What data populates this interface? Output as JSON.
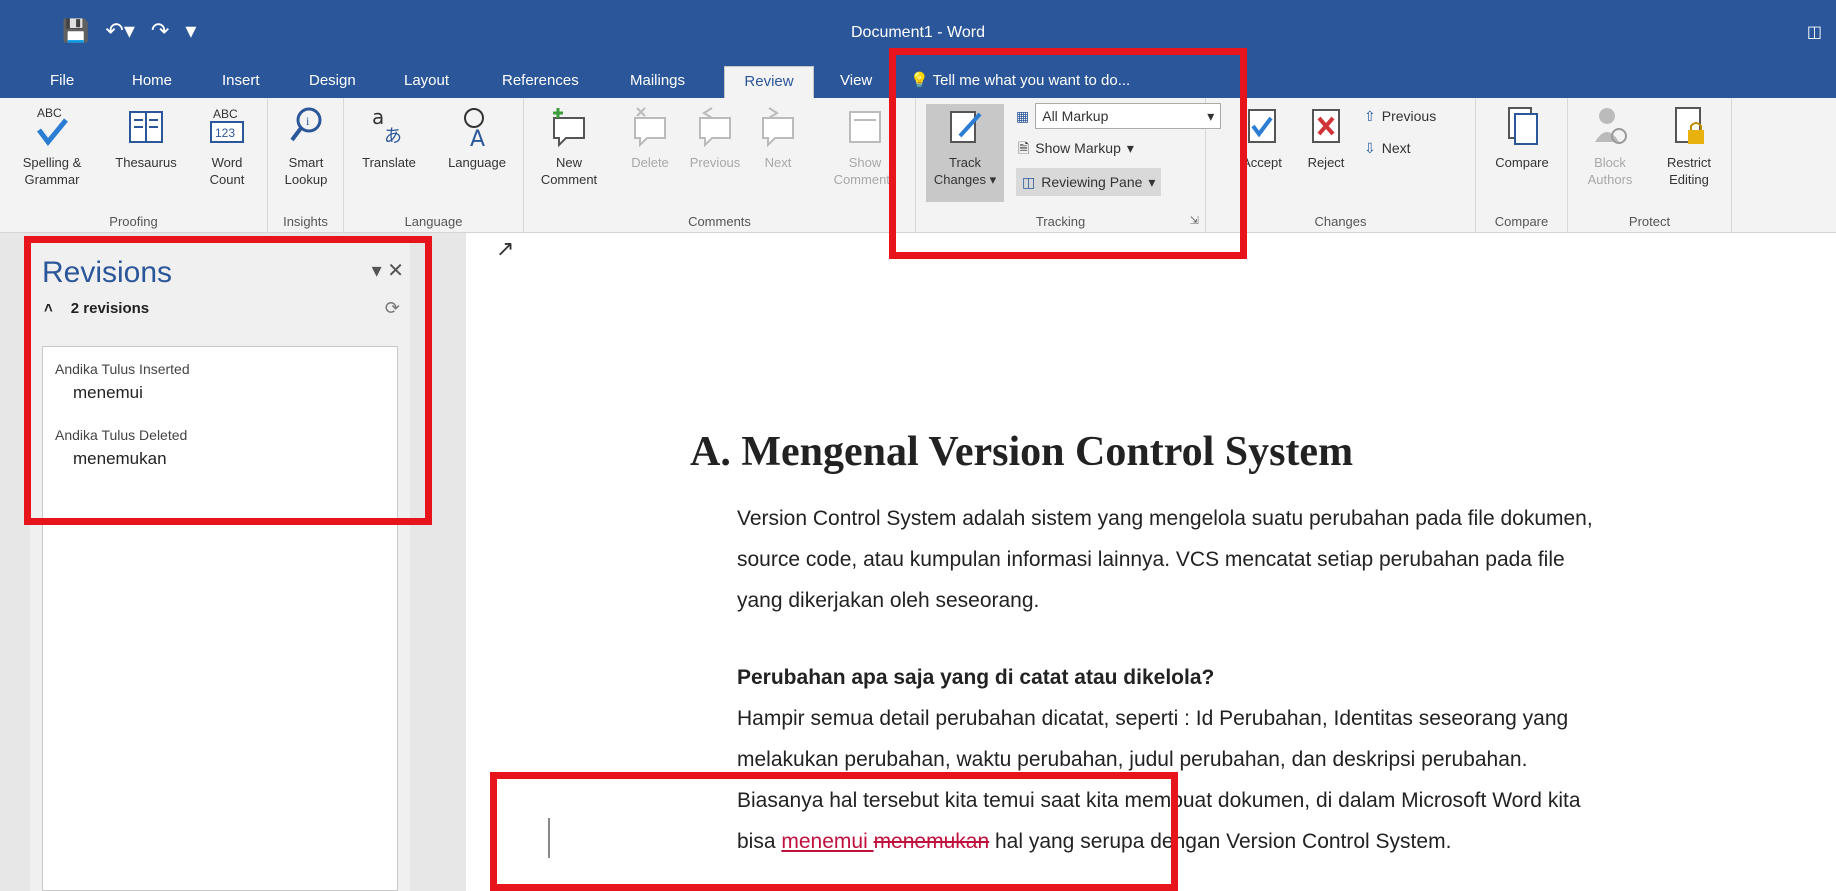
{
  "app": {
    "window_title": "Document1 - Word",
    "qat_icons": [
      "save-icon",
      "undo-icon",
      "redo-icon",
      "customize-icon"
    ]
  },
  "tabs": [
    {
      "label": "File"
    },
    {
      "label": "Home"
    },
    {
      "label": "Insert"
    },
    {
      "label": "Design"
    },
    {
      "label": "Layout"
    },
    {
      "label": "References"
    },
    {
      "label": "Mailings"
    },
    {
      "label": "Review",
      "active": true
    },
    {
      "label": "View"
    }
  ],
  "tell_me": "Tell me what you want to do...",
  "ribbon": {
    "proofing": {
      "label": "Proofing",
      "spelling": "Spelling & Grammar",
      "spelling_l1": "Spelling &",
      "spelling_l2": "Grammar",
      "thesaurus": "Thesaurus",
      "wordcount_l1": "Word",
      "wordcount_l2": "Count",
      "abc": "ABC",
      "n123": "123"
    },
    "insights": {
      "label": "Insights",
      "smart_l1": "Smart",
      "smart_l2": "Lookup"
    },
    "language": {
      "label": "Language",
      "translate": "Translate",
      "language": "Language"
    },
    "comments": {
      "label": "Comments",
      "new_l1": "New",
      "new_l2": "Comment",
      "delete": "Delete",
      "previous": "Previous",
      "next": "Next",
      "show_l1": "Show",
      "show_l2": "Comments"
    },
    "tracking": {
      "label": "Tracking",
      "track_l1": "Track",
      "track_l2": "Changes",
      "markup_select": "All Markup",
      "show_markup": "Show Markup",
      "reviewing_pane": "Reviewing Pane"
    },
    "changes": {
      "label": "Changes",
      "accept": "Accept",
      "reject": "Reject",
      "previous": "Previous",
      "next": "Next"
    },
    "compare": {
      "label": "Compare",
      "compare": "Compare"
    },
    "protect": {
      "label": "Protect",
      "block_l1": "Block",
      "block_l2": "Authors",
      "restrict_l1": "Restrict",
      "restrict_l2": "Editing"
    }
  },
  "revisions": {
    "title": "Revisions",
    "count": "2 revisions",
    "items": [
      {
        "author_action": "Andika Tulus Inserted",
        "text": "menemui"
      },
      {
        "author_action": "Andika Tulus Deleted",
        "text": "menemukan"
      }
    ]
  },
  "document": {
    "heading": "A. Mengenal Version Control System",
    "p1_l1": "Version Control System adalah sistem yang mengelola suatu perubahan pada file dokumen,",
    "p1_l2": "source code, atau kumpulan informasi lainnya. VCS mencatat setiap perubahan pada file",
    "p1_l3": "yang dikerjakan oleh seseorang.",
    "q_title": "Perubahan apa saja yang di catat atau dikelola?",
    "p2_l1": "Hampir semua detail perubahan dicatat, seperti : Id Perubahan, Identitas seseorang yang",
    "p2_l2": "melakukan perubahan, waktu perubahan, judul perubahan, dan deskripsi perubahan.",
    "p2_l3": "Biasanya hal tersebut kita temui saat kita membuat dokumen, di dalam Microsoft Word kita",
    "p2_l4_pre": "bisa ",
    "p2_l4_ins": "menemui ",
    "p2_l4_del": "menemukan",
    "p2_l4_post": " hal yang serupa dengan Version Control System."
  },
  "colors": {
    "word_blue": "#2b579a",
    "highlight_red": "#e8141c",
    "revision_red": "#c0103c"
  }
}
